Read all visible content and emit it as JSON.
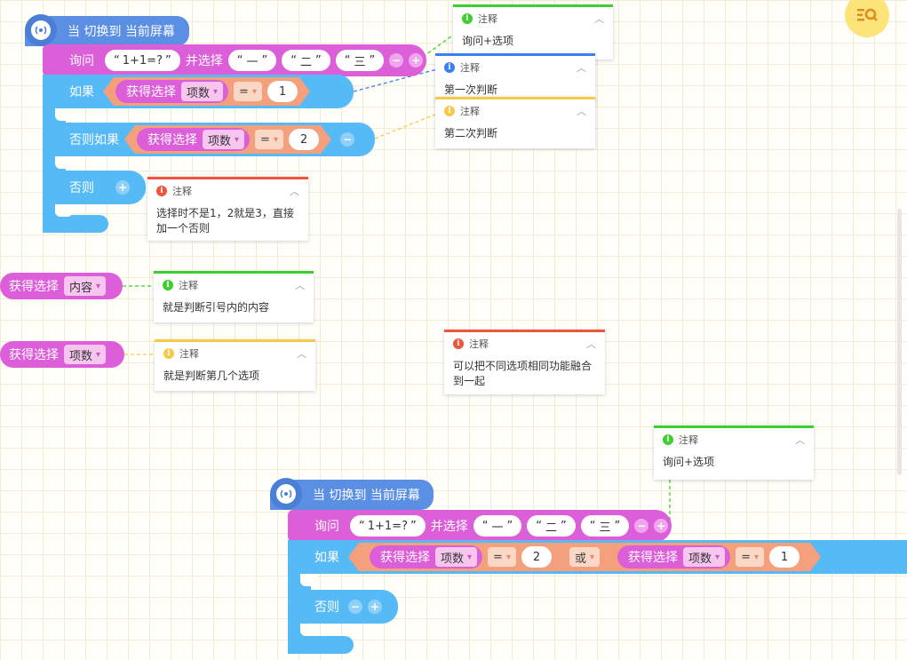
{
  "event_label": "当 切换到 当前屏幕",
  "ask": {
    "label": "询问",
    "question": "1+1=?",
    "and_choose": "并选择",
    "options": [
      "一",
      "二",
      "三"
    ]
  },
  "if1": {
    "if": "如果",
    "else_if": "否则如果",
    "else": "否则",
    "get_choice": "获得选择",
    "mode": "项数",
    "op": "=",
    "value1": "1",
    "value2": "2"
  },
  "standalone": [
    {
      "label": "获得选择",
      "mode": "内容"
    },
    {
      "label": "获得选择",
      "mode": "项数"
    }
  ],
  "if2": {
    "if": "如果",
    "else": "否则",
    "get_choice": "获得选择",
    "mode": "项数",
    "op": "=",
    "value_a": "2",
    "or": "或",
    "value_b": "1"
  },
  "comment_header": "注释",
  "comments": [
    {
      "text": "询问+选项",
      "color": "#3ccf2f"
    },
    {
      "text": "第一次判断",
      "color": "#3b7ff0"
    },
    {
      "text": "第二次判断",
      "color": "#f6c94a"
    },
    {
      "text": "选择时不是1，2就是3，直接加一个否则",
      "color": "#f0533e"
    },
    {
      "text": "就是判断引号内的内容",
      "color": "#3ccf2f"
    },
    {
      "text": "就是判断第几个选项",
      "color": "#f6c94a"
    },
    {
      "text": "可以把不同选项相同功能融合到一起",
      "color": "#f0533e"
    },
    {
      "text": "询问+选项",
      "color": "#3ccf2f"
    }
  ],
  "colors": {
    "event": "#5a8fe4",
    "looks": "#dc5fd9",
    "control": "#55baf5",
    "operator": "#f4a07c"
  },
  "icons": {
    "event": "broadcast-icon",
    "fab": "zoom-search-icon"
  }
}
